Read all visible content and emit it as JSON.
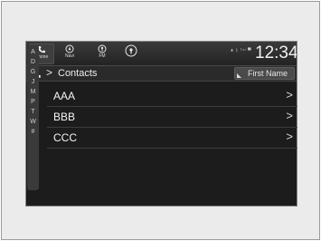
{
  "topbar": {
    "buttons": [
      {
        "label": "Phone",
        "icon": "phone-icon"
      },
      {
        "label": "Navi",
        "icon": "navi-icon"
      },
      {
        "label": "FM",
        "icon": "radio-icon"
      },
      {
        "label": "",
        "icon": "audio-source-icon"
      }
    ],
    "status_text": "▮ ᛒ ᵀᵉˡ ▀",
    "clock": "12:34"
  },
  "navbar": {
    "separator": ">",
    "title": "Contacts",
    "sort_button_label": "First Name"
  },
  "alpha_index": [
    "A",
    "D",
    "G",
    "J",
    "M",
    "P",
    "T",
    "W",
    "#"
  ],
  "contacts": [
    {
      "name": "AAA",
      "chevron": ">"
    },
    {
      "name": "BBB",
      "chevron": ">"
    },
    {
      "name": "CCC",
      "chevron": ">"
    }
  ]
}
